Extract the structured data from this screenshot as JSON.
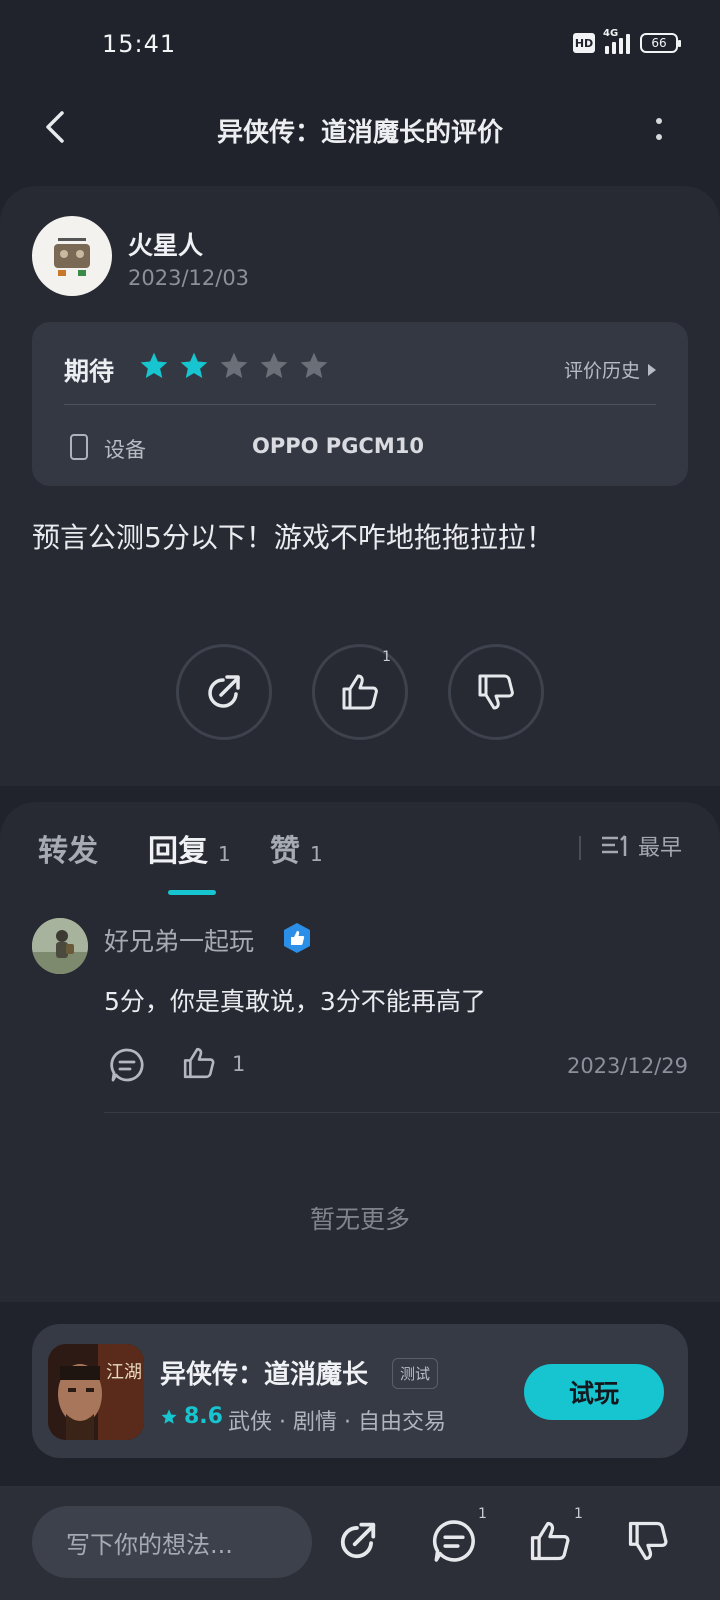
{
  "status_bar": {
    "time": "15:41",
    "hd": "HD",
    "network": "4G",
    "battery": "66"
  },
  "header": {
    "title": "异侠传：道消魔长的评价"
  },
  "review": {
    "author": "火星人",
    "date": "2023/12/03",
    "rating_label": "期待",
    "rating": 2,
    "rating_max": 5,
    "history_label": "评价历史",
    "device_label": "设备",
    "device_value": "OPPO PGCM10",
    "text": "预言公测5分以下！游戏不咋地拖拖拉拉！",
    "like_count": "1"
  },
  "tabs": [
    {
      "label": "转发",
      "count": ""
    },
    {
      "label": "回复",
      "count": "1"
    },
    {
      "label": "赞",
      "count": "1"
    }
  ],
  "sort": {
    "label": "最早",
    "icon": "sort-icon"
  },
  "replies": [
    {
      "author": "好兄弟一起玩",
      "text": "5分，你是真敢说，3分不能再高了",
      "like_count": "1",
      "date": "2023/12/29"
    }
  ],
  "no_more_text": "暂无更多",
  "game": {
    "title": "异侠传：道消魔长",
    "badge": "测试",
    "score": "8.6",
    "tags": "武侠 · 剧情 · 自由交易",
    "play_label": "试玩",
    "icon_text": "江湖"
  },
  "bottom_bar": {
    "input_placeholder": "写下你的想法...",
    "comment_count": "1",
    "like_count": "1"
  },
  "colors": {
    "accent": "#16c5cf",
    "background": "#20232b",
    "card": "#272a33",
    "star_inactive": "#6b6f78"
  }
}
